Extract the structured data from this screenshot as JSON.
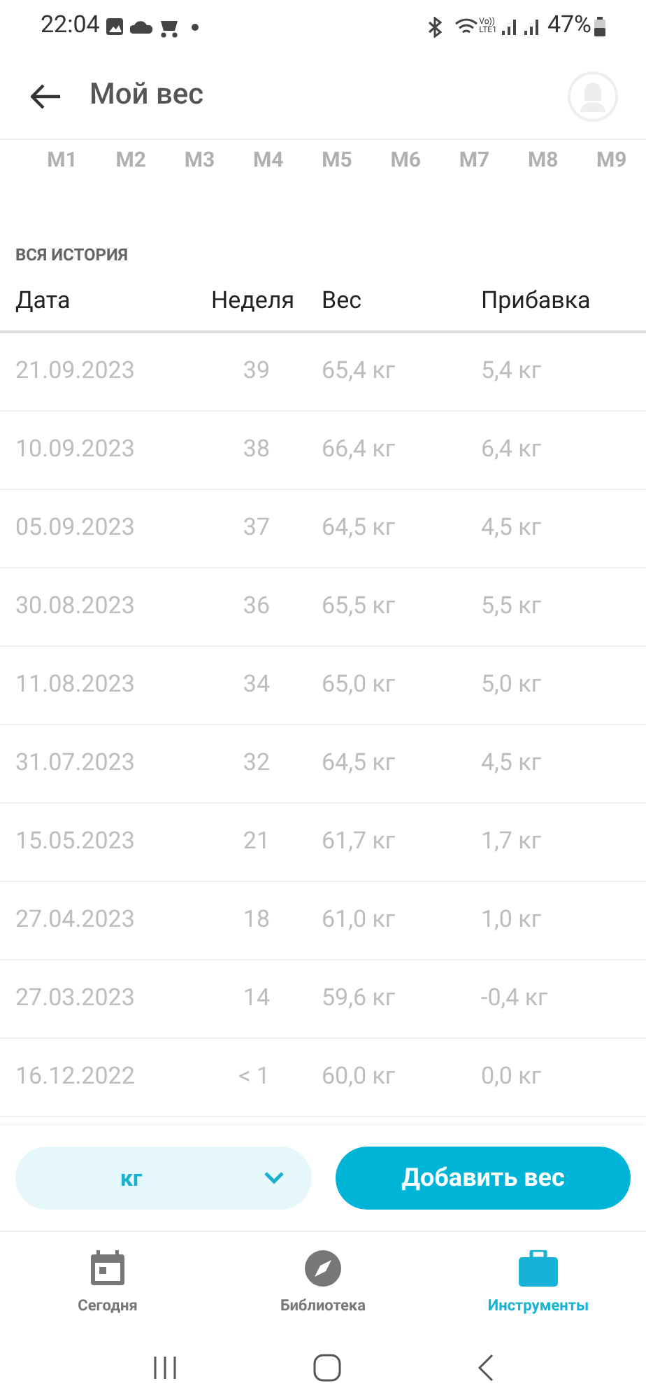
{
  "status_bar": {
    "time": "22:04",
    "network_top": "Vo))",
    "network_bottom": "LTE1",
    "battery": "47%"
  },
  "header": {
    "title": "Мой вес"
  },
  "months": [
    "M1",
    "M2",
    "M3",
    "M4",
    "M5",
    "M6",
    "M7",
    "M8",
    "M9"
  ],
  "section_title": "ВСЯ ИСТОРИЯ",
  "table": {
    "columns": [
      "Дата",
      "Неделя",
      "Вес",
      "Прибавка"
    ],
    "rows": [
      [
        "21.09.2023",
        "39",
        "65,4 кг",
        "5,4 кг"
      ],
      [
        "10.09.2023",
        "38",
        "66,4 кг",
        "6,4 кг"
      ],
      [
        "05.09.2023",
        "37",
        "64,5 кг",
        "4,5 кг"
      ],
      [
        "30.08.2023",
        "36",
        "65,5 кг",
        "5,5 кг"
      ],
      [
        "11.08.2023",
        "34",
        "65,0 кг",
        "5,0 кг"
      ],
      [
        "31.07.2023",
        "32",
        "64,5 кг",
        "4,5 кг"
      ],
      [
        "15.05.2023",
        "21",
        "61,7 кг",
        "1,7 кг"
      ],
      [
        "27.04.2023",
        "18",
        "61,0 кг",
        "1,0 кг"
      ],
      [
        "27.03.2023",
        "14",
        "59,6 кг",
        "-0,4 кг"
      ],
      [
        "16.12.2022",
        "< 1",
        "60,0 кг",
        "0,0 кг"
      ]
    ]
  },
  "unit_select": {
    "value": "кг"
  },
  "add_button": "Добавить вес",
  "bottom_nav": [
    {
      "kind": "calendar",
      "label": "Сегодня",
      "selected": false
    },
    {
      "kind": "compass",
      "label": "Библиотека",
      "selected": false
    },
    {
      "kind": "briefcase",
      "label": "Инструменты",
      "selected": true
    }
  ]
}
